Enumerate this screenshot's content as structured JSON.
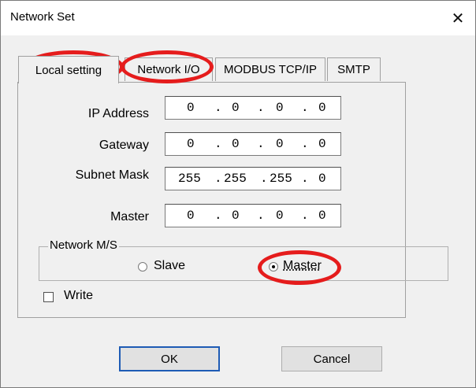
{
  "window": {
    "title": "Network Set",
    "close_glyph": "✕"
  },
  "tabs": [
    {
      "label": "Local setting",
      "active": true
    },
    {
      "label": "Network I/O",
      "active": false
    },
    {
      "label": "MODBUS TCP/IP",
      "active": false
    },
    {
      "label": "SMTP",
      "active": false
    }
  ],
  "fields": {
    "ip_address": {
      "label": "IP Address",
      "octets": [
        "0",
        "0",
        "0",
        "0"
      ]
    },
    "gateway": {
      "label": "Gateway",
      "octets": [
        "0",
        "0",
        "0",
        "0"
      ]
    },
    "subnet_mask": {
      "label": "Subnet Mask",
      "octets": [
        "255",
        "255",
        "255",
        "0"
      ]
    },
    "master": {
      "label": "Master",
      "octets": [
        "0",
        "0",
        "0",
        "0"
      ]
    }
  },
  "network_ms": {
    "group_label": "Network M/S",
    "options": [
      {
        "label": "Slave",
        "selected": false
      },
      {
        "label": "Master",
        "selected": true
      }
    ]
  },
  "write": {
    "label": "Write",
    "checked": false
  },
  "buttons": {
    "ok": "OK",
    "cancel": "Cancel"
  },
  "annotation_color": "#e51c1c"
}
